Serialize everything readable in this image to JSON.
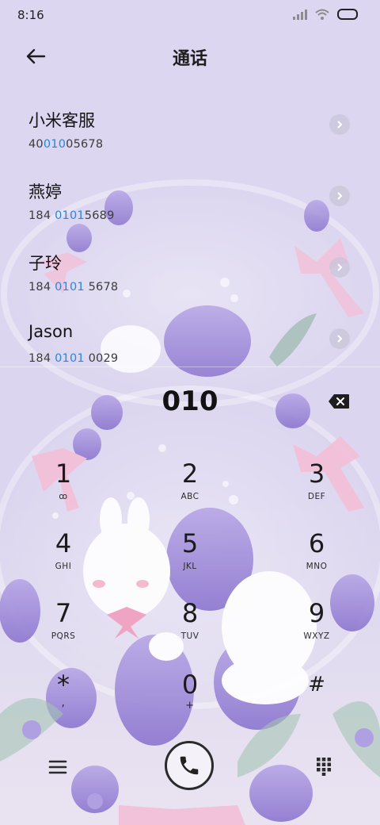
{
  "status_bar": {
    "time": "8:16",
    "icons": [
      "signal-icon",
      "wifi-icon",
      "battery-icon"
    ]
  },
  "header": {
    "title": "通话",
    "back_icon": "back-arrow-icon"
  },
  "contacts": [
    {
      "name": "小米客服",
      "number_pre": "40",
      "number_match": "010",
      "number_post": "05678"
    },
    {
      "name": "燕婷",
      "number_pre": "184 ",
      "number_match": "0101",
      "number_post": "5689"
    },
    {
      "name": "子玲",
      "number_pre": "184 ",
      "number_match": "0101",
      "number_post": " 5678"
    },
    {
      "name": "Jason",
      "number_pre": "184 ",
      "number_match": "0101",
      "number_post": " 0029"
    }
  ],
  "dialer": {
    "input_value": "010",
    "keys": [
      {
        "digit": "1",
        "letters": "ꝏ"
      },
      {
        "digit": "2",
        "letters": "ABC"
      },
      {
        "digit": "3",
        "letters": "DEF"
      },
      {
        "digit": "4",
        "letters": "GHI"
      },
      {
        "digit": "5",
        "letters": "JKL"
      },
      {
        "digit": "6",
        "letters": "MNO"
      },
      {
        "digit": "7",
        "letters": "PQRS"
      },
      {
        "digit": "8",
        "letters": "TUV"
      },
      {
        "digit": "9",
        "letters": "WXYZ"
      },
      {
        "digit": "*",
        "letters": ","
      },
      {
        "digit": "0",
        "letters": "+"
      },
      {
        "digit": "#",
        "letters": ""
      }
    ]
  },
  "colors": {
    "accent": "#2a86db",
    "background": "#dcd6f0"
  }
}
